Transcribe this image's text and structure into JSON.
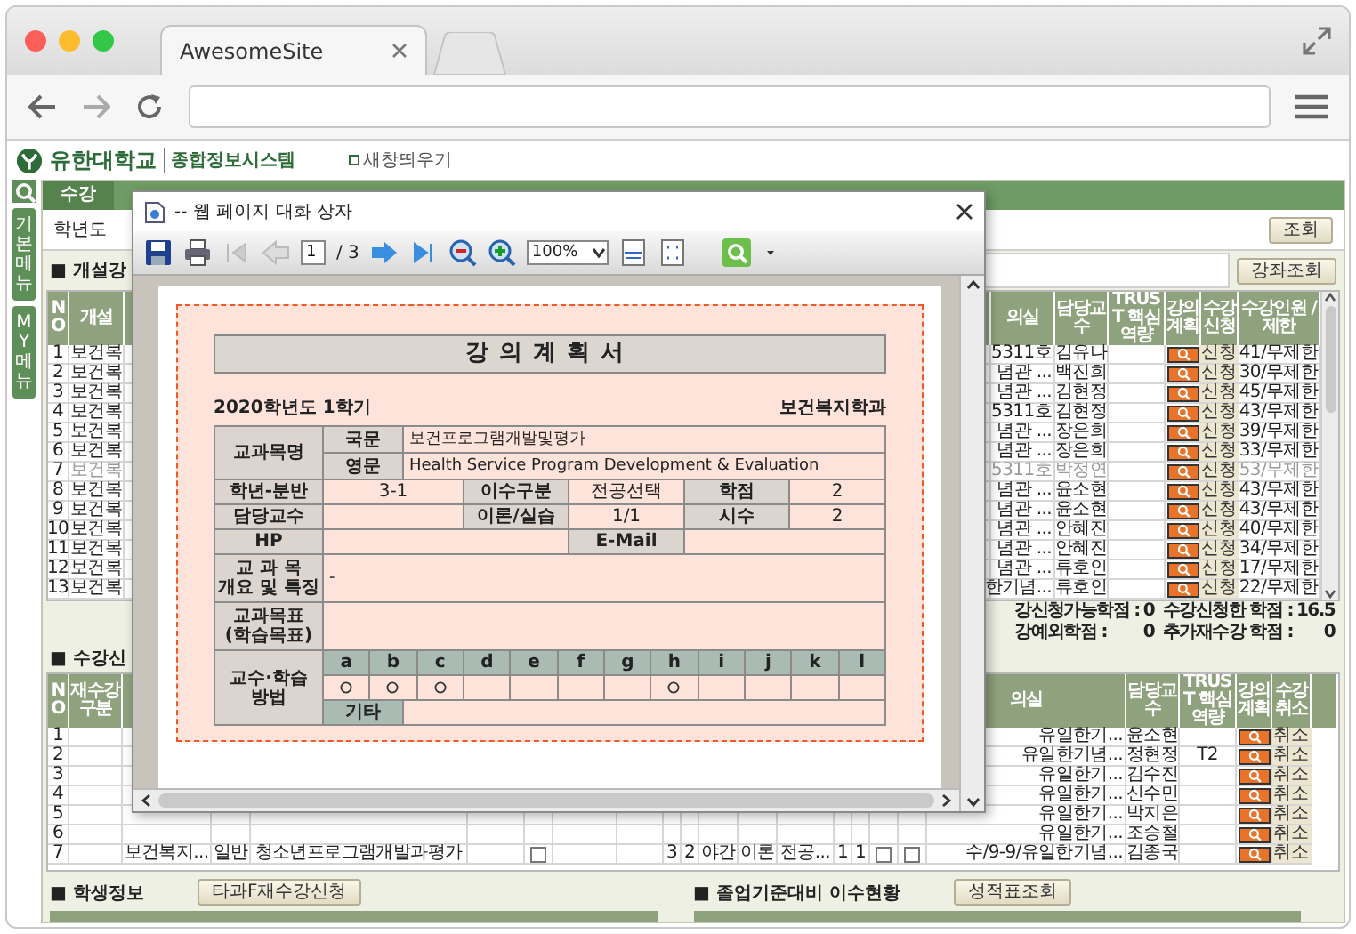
{
  "browser": {
    "tab_title": "AwesomeSite"
  },
  "site": {
    "university": "유한대학교",
    "system": "종합정보시스템",
    "new_window": "새창띄우기"
  },
  "sidebar": [
    "기본메뉴",
    "MY메뉴"
  ],
  "menu_tab": "수강",
  "query": {
    "year_label": "학년도",
    "button": "조회"
  },
  "offered": {
    "title": "■ 개설강",
    "button": "강좌조회",
    "columns_left": [
      "NO",
      "개설"
    ],
    "columns_right": [
      "의실",
      "담당교수",
      "TRUST 핵심역량",
      "강의 계획",
      "수강 신청",
      "수강인원 /제한"
    ],
    "rows": [
      {
        "no": "1",
        "name": "보건복",
        "room": "5311호",
        "professor": "김유나",
        "apply": "신청",
        "enrollment": "41/무제한",
        "disabled": false
      },
      {
        "no": "2",
        "name": "보건복",
        "room": "념관 ...",
        "professor": "백진희",
        "apply": "신청",
        "enrollment": "30/무제한",
        "disabled": false
      },
      {
        "no": "3",
        "name": "보건복",
        "room": "념관 ...",
        "professor": "김현정",
        "apply": "신청",
        "enrollment": "45/무제한",
        "disabled": false
      },
      {
        "no": "4",
        "name": "보건복",
        "room": "5311호",
        "professor": "김현정",
        "apply": "신청",
        "enrollment": "43/무제한",
        "disabled": false
      },
      {
        "no": "5",
        "name": "보건복",
        "room": "념관 ...",
        "professor": "장은희",
        "apply": "신청",
        "enrollment": "39/무제한",
        "disabled": false
      },
      {
        "no": "6",
        "name": "보건복",
        "room": "념관 ...",
        "professor": "장은희",
        "apply": "신청",
        "enrollment": "33/무제한",
        "disabled": false
      },
      {
        "no": "7",
        "name": "보건복",
        "room": "5311호",
        "professor": "박정연",
        "apply": "신청",
        "enrollment": "53/무제한",
        "disabled": true
      },
      {
        "no": "8",
        "name": "보건복",
        "room": "념관 ...",
        "professor": "윤소현",
        "apply": "신청",
        "enrollment": "43/무제한",
        "disabled": false
      },
      {
        "no": "9",
        "name": "보건복",
        "room": "념관 ...",
        "professor": "윤소현",
        "apply": "신청",
        "enrollment": "43/무제한",
        "disabled": false
      },
      {
        "no": "10",
        "name": "보건복",
        "room": "념관 ...",
        "professor": "안혜진",
        "apply": "신청",
        "enrollment": "40/무제한",
        "disabled": false
      },
      {
        "no": "11",
        "name": "보건복",
        "room": "념관 ...",
        "professor": "안혜진",
        "apply": "신청",
        "enrollment": "34/무제한",
        "disabled": false
      },
      {
        "no": "12",
        "name": "보건복",
        "room": "념관 ...",
        "professor": "류호인",
        "apply": "신청",
        "enrollment": "17/무제한",
        "disabled": false
      },
      {
        "no": "13",
        "name": "보건복",
        "room": "한기념...",
        "professor": "류호인",
        "apply": "신청",
        "enrollment": "22/무제한",
        "disabled": false
      }
    ]
  },
  "credits": [
    [
      {
        "label": "강신청가능학점 :",
        "value": "0"
      },
      {
        "label": "수강신청한 학점 :",
        "value": "16.5"
      }
    ],
    [
      {
        "label": "강예외학점 :",
        "value": "0"
      },
      {
        "label": "추가재수강 학점 :",
        "value": "0"
      }
    ]
  ],
  "registered": {
    "title": "■ 수강신",
    "columns_left": [
      "NO",
      "재수강구분"
    ],
    "columns_right": [
      "의실",
      "담당교수",
      "TRUST 핵심역량",
      "강의 계획",
      "수강 취소"
    ],
    "rows": [
      {
        "no": "1",
        "room": "유일한기...",
        "professor": "윤소현",
        "cancel": "취소"
      },
      {
        "no": "2",
        "room": "유일한기념...",
        "professor": "정현정",
        "trust": "T2",
        "cancel": "취소"
      },
      {
        "no": "3",
        "room": "유일한기...",
        "professor": "김수진",
        "cancel": "취소"
      },
      {
        "no": "4",
        "room": "유일한기...",
        "professor": "신수민",
        "cancel": "취소"
      },
      {
        "no": "5",
        "room": "유일한기...",
        "professor": "박지은",
        "cancel": "취소"
      },
      {
        "no": "6",
        "room": "유일한기...",
        "professor": "조승철",
        "cancel": "취소"
      },
      {
        "no": "7",
        "room": "수/9-9/유일한기념...",
        "professor": "김종국",
        "cancel": "취소",
        "cells": [
          {
            "kind": "blank"
          },
          {
            "kind": "text",
            "text": "보건복지..."
          },
          {
            "kind": "text",
            "text": "일반"
          },
          {
            "kind": "text",
            "text": "청소년프로그램개발과평가"
          },
          {
            "kind": "blank"
          },
          {
            "kind": "checkbox",
            "checked": false
          },
          {
            "kind": "blank"
          },
          {
            "kind": "blank"
          },
          {
            "kind": "text",
            "text": "3"
          },
          {
            "kind": "text",
            "text": "2"
          },
          {
            "kind": "text",
            "text": "야간"
          },
          {
            "kind": "text",
            "text": "이론"
          },
          {
            "kind": "text",
            "text": "전공..."
          },
          {
            "kind": "text",
            "text": "1"
          },
          {
            "kind": "text",
            "text": "1"
          },
          {
            "kind": "checkbox",
            "checked": false
          },
          {
            "kind": "checkbox",
            "checked": false
          }
        ]
      }
    ]
  },
  "student": {
    "title": "■ 학생정보",
    "button": "타과F재수강신청"
  },
  "graduation": {
    "title": "■ 졸업기준대비 이수현황",
    "button": "성적표조회"
  },
  "dialog": {
    "title": "-- 웹 페이지 대화 상자",
    "page": "1",
    "page_count": "/ 3",
    "zoom": "100%",
    "document": {
      "title": "강의계획서",
      "term": "2020학년도 1학기",
      "department": "보건복지학과",
      "course_label": "교과목명",
      "names": [
        {
          "label": "국문",
          "value": "보건프로그램개발및평가"
        },
        {
          "label": "영문",
          "value": "Health Service Program Development & Evaluation"
        }
      ],
      "rows": [
        {
          "cells": [
            {
              "kind": "label",
              "lines": [
                "학년-분반"
              ]
            },
            {
              "kind": "value",
              "lines": [
                "3-1"
              ]
            },
            {
              "kind": "label",
              "lines": [
                "이수구분"
              ]
            },
            {
              "kind": "value",
              "lines": [
                "전공선택"
              ]
            },
            {
              "kind": "label",
              "lines": [
                "학점"
              ]
            },
            {
              "kind": "value",
              "lines": [
                "2"
              ]
            }
          ]
        },
        {
          "cells": [
            {
              "kind": "label",
              "lines": [
                "담당교수"
              ]
            },
            {
              "kind": "value"
            },
            {
              "kind": "label",
              "lines": [
                "이론/실습"
              ]
            },
            {
              "kind": "value",
              "lines": [
                "1/1"
              ]
            },
            {
              "kind": "label",
              "lines": [
                "시수"
              ]
            },
            {
              "kind": "value",
              "lines": [
                "2"
              ]
            }
          ]
        },
        {
          "cells": [
            {
              "kind": "label",
              "lines": [
                "HP"
              ]
            },
            {
              "kind": "value"
            },
            {
              "kind": "merged"
            },
            {
              "kind": "label",
              "lines": [
                "E-Mail"
              ]
            },
            {
              "kind": "value"
            },
            {
              "kind": "merged"
            }
          ]
        },
        {
          "cells": [
            {
              "kind": "label",
              "lines": [
                "교 과 목",
                "개요 및 특징"
              ]
            },
            {
              "kind": "value",
              "lines": [
                "-"
              ]
            }
          ]
        },
        {
          "cells": [
            {
              "kind": "label",
              "lines": [
                "교과목표",
                "(학습목표)"
              ]
            },
            {
              "kind": "value"
            }
          ]
        }
      ],
      "methods": {
        "lines": [
          "교수·학습",
          "방법"
        ],
        "other_label": "기타",
        "items": [
          {
            "letter": "a",
            "checked": true
          },
          {
            "letter": "b",
            "checked": true
          },
          {
            "letter": "c",
            "checked": true
          },
          {
            "letter": "d",
            "checked": false
          },
          {
            "letter": "e",
            "checked": false
          },
          {
            "letter": "f",
            "checked": false
          },
          {
            "letter": "g",
            "checked": false
          },
          {
            "letter": "h",
            "checked": true
          },
          {
            "letter": "i",
            "checked": false
          },
          {
            "letter": "j",
            "checked": false
          },
          {
            "letter": "k",
            "checked": false
          },
          {
            "letter": "l",
            "checked": false
          }
        ]
      }
    }
  }
}
